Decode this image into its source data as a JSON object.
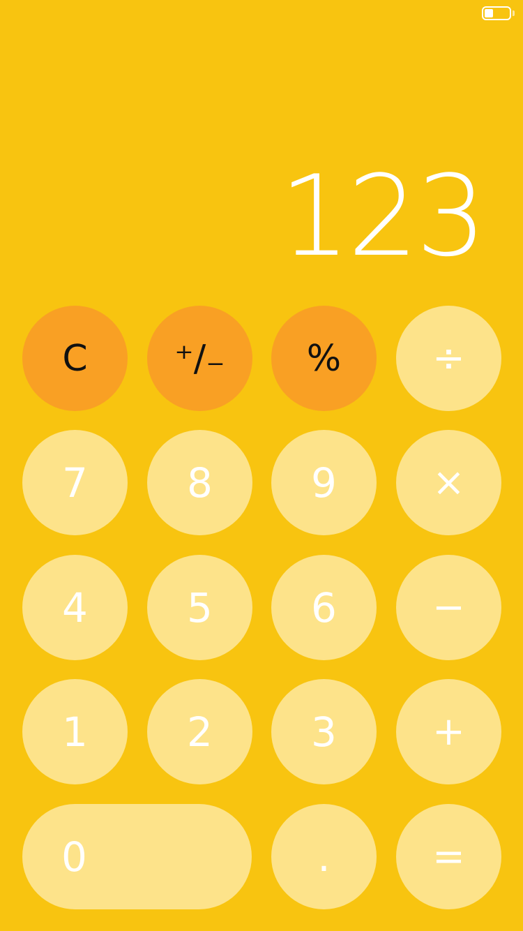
{
  "status_bar": {
    "battery_level": 0.35,
    "battery_icon": "battery-icon"
  },
  "display": {
    "value": "123"
  },
  "colors": {
    "background": "#F8C410",
    "function_key": "#F9A024",
    "key": "#FDE38A",
    "key_text": "#FFFFFF",
    "function_key_text": "#111111"
  },
  "keys": {
    "clear": "C",
    "toggle_sign": "⁺∕₋",
    "percent": "%",
    "divide": "÷",
    "seven": "7",
    "eight": "8",
    "nine": "9",
    "multiply": "×",
    "four": "4",
    "five": "5",
    "six": "6",
    "subtract": "−",
    "one": "1",
    "two": "2",
    "three": "3",
    "add": "+",
    "zero": "0",
    "decimal": ".",
    "equals": "="
  }
}
